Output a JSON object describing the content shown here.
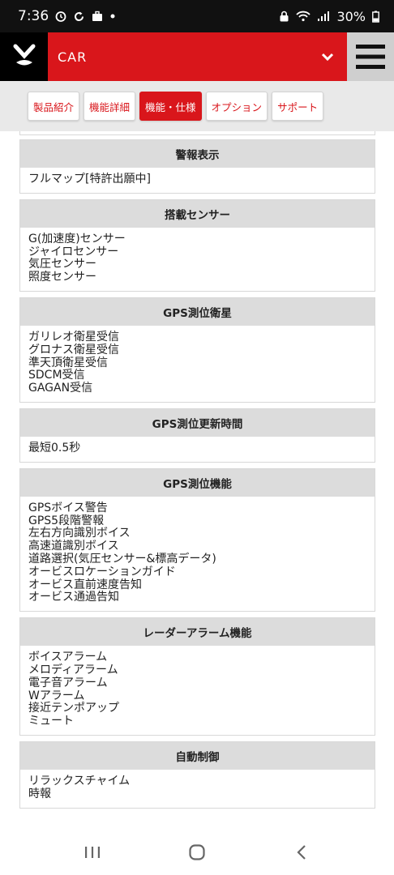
{
  "status": {
    "time": "7:36",
    "battery": "30%"
  },
  "header": {
    "title": "CAR",
    "logo_icon": "y-logo-icon",
    "dropdown_icon": "chevron-down-icon",
    "menu_icon": "hamburger-menu-icon"
  },
  "tabs": [
    {
      "label": "製品紹介",
      "active": false
    },
    {
      "label": "機能詳細",
      "active": false
    },
    {
      "label": "機能・仕様",
      "active": true
    },
    {
      "label": "オプション",
      "active": false
    },
    {
      "label": "サポート",
      "active": false
    }
  ],
  "sections": [
    {
      "title": "警報表示",
      "items": [
        "フルマップ[特許出願中]"
      ]
    },
    {
      "title": "搭載センサー",
      "items": [
        "G(加速度)センサー",
        "ジャイロセンサー",
        "気圧センサー",
        "照度センサー"
      ]
    },
    {
      "title": "GPS測位衛星",
      "items": [
        "ガリレオ衛星受信",
        "グロナス衛星受信",
        "準天頂衛星受信",
        "SDCM受信",
        "GAGAN受信"
      ]
    },
    {
      "title": "GPS測位更新時間",
      "items": [
        "最短0.5秒"
      ]
    },
    {
      "title": "GPS測位機能",
      "items": [
        "GPSボイス警告",
        "GPS5段階警報",
        "左右方向識別ボイス",
        "高速道識別ボイス",
        "道路選択(気圧センサー&標高データ)",
        "オービスロケーションガイド",
        "オービス直前速度告知",
        "オービス通過告知"
      ]
    },
    {
      "title": "レーダーアラーム機能",
      "items": [
        "ボイスアラーム",
        "メロディアラーム",
        "電子音アラーム",
        "Wアラーム",
        "接近テンポアップ",
        "ミュート"
      ]
    },
    {
      "title": "自動制御",
      "items": [
        "リラックスチャイム",
        "時報"
      ]
    }
  ],
  "colors": {
    "brand": "#d9161b",
    "menu_bg": "#cfcfcf",
    "section_head": "#dcdcdc"
  }
}
